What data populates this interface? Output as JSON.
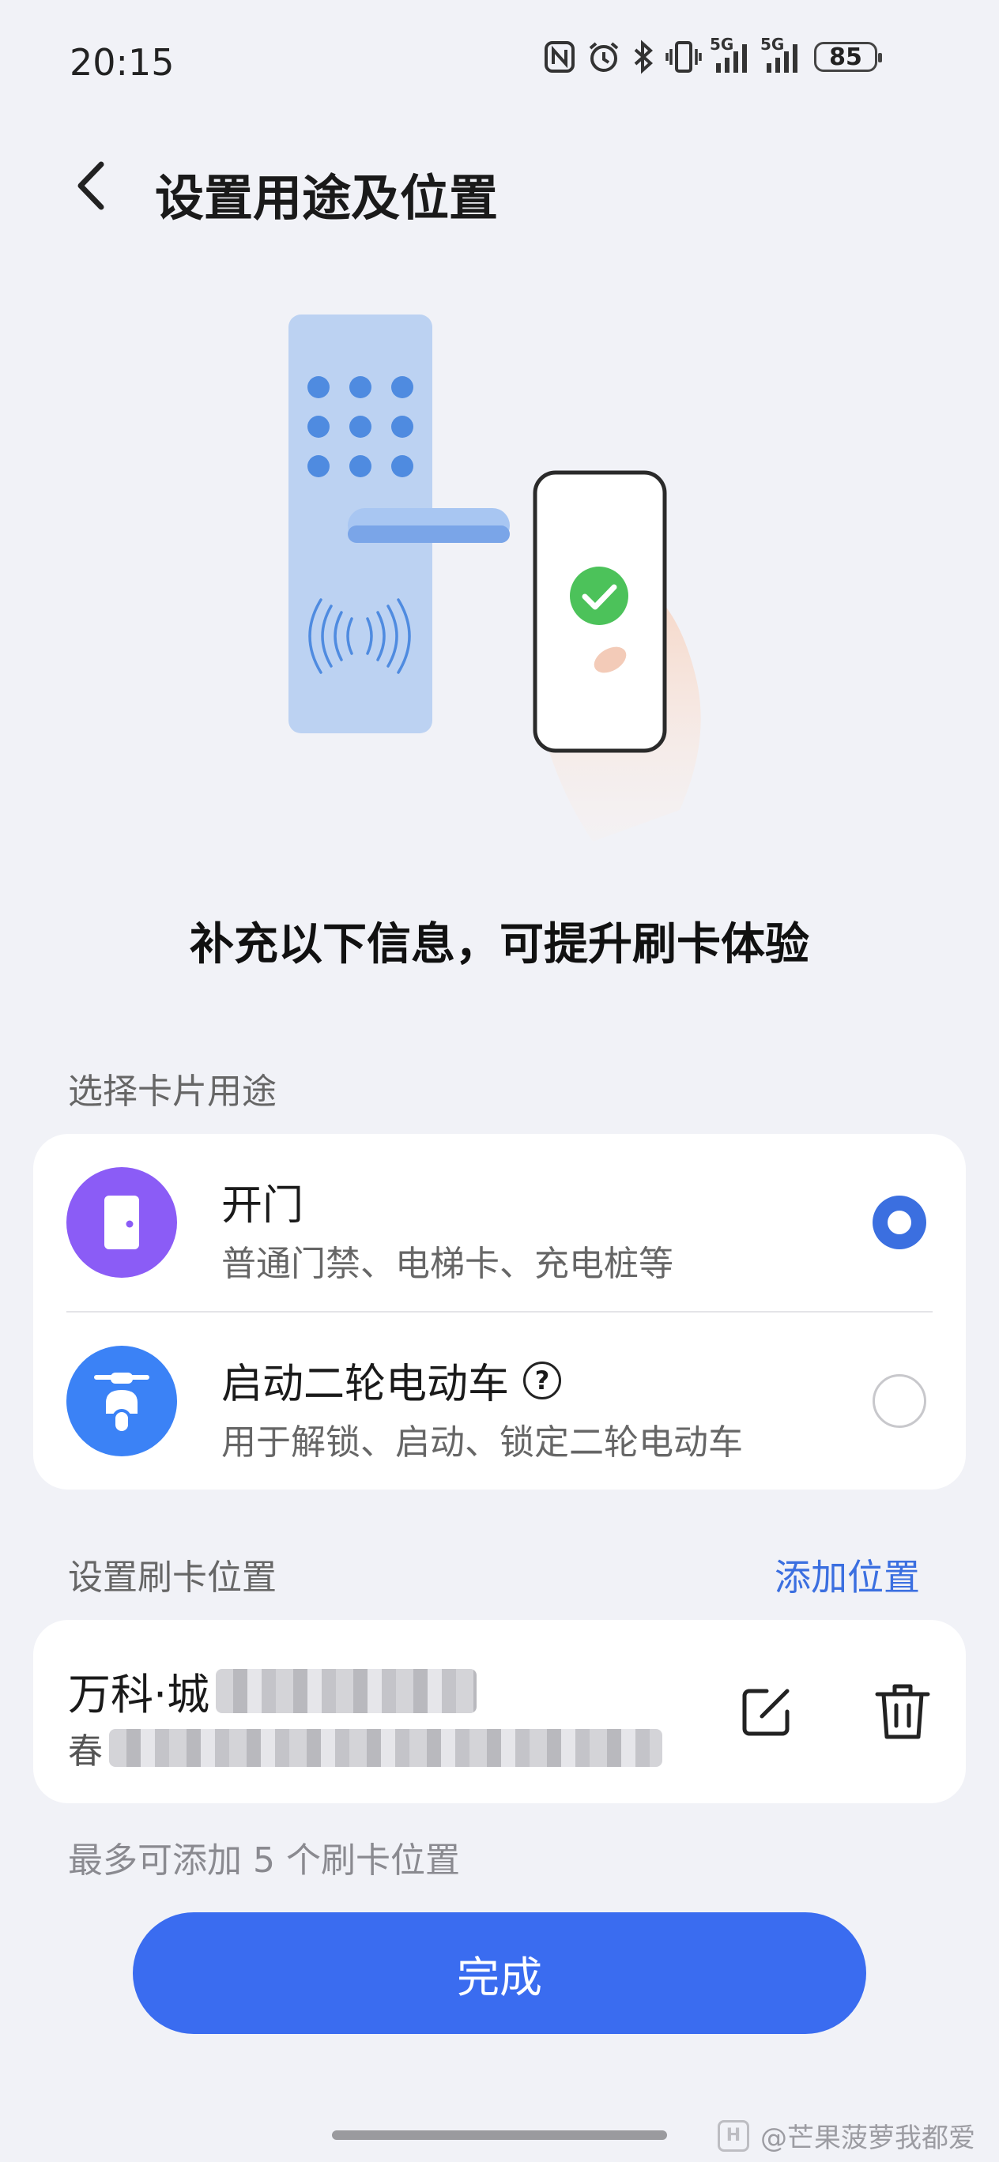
{
  "status_bar": {
    "time": "20:15",
    "network_label": "5G",
    "battery": "85",
    "icons": [
      "nfc-icon",
      "alarm-icon",
      "bluetooth-icon",
      "vibrate-icon",
      "signal-icon",
      "signal-icon",
      "battery-icon"
    ]
  },
  "header": {
    "back_icon": "chevron-left-icon",
    "title": "设置用途及位置"
  },
  "subtitle": "补充以下信息，可提升刷卡体验",
  "purpose": {
    "label": "选择卡片用途",
    "options": [
      {
        "title": "开门",
        "desc": "普通门禁、电梯卡、充电桩等",
        "icon": "door-icon",
        "icon_color": "#8b5cf6",
        "selected": true
      },
      {
        "title": "启动二轮电动车",
        "desc": "用于解锁、启动、锁定二轮电动车",
        "icon": "scooter-icon",
        "icon_color": "#3b82f6",
        "selected": false,
        "help_icon": "question-icon"
      }
    ]
  },
  "location": {
    "label": "设置刷卡位置",
    "add_label": "添加位置",
    "items": [
      {
        "name_visible": "万科·城",
        "addr_visible": "春"
      }
    ],
    "note": "最多可添加 5 个刷卡位置"
  },
  "done_button": "完成",
  "watermark": "@芒果菠萝我都爱",
  "colors": {
    "accent": "#3a6cf0",
    "background": "#f1f2f7"
  }
}
